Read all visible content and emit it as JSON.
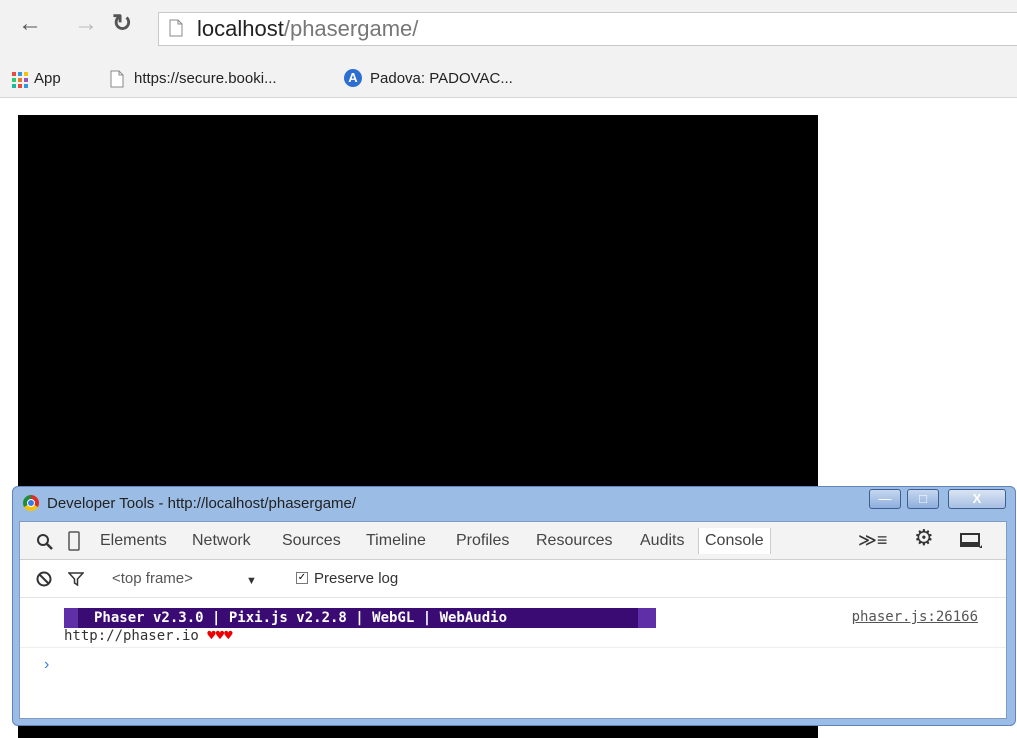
{
  "browser": {
    "url_host": "localhost",
    "url_path": "/phasergame/",
    "bookmarks": [
      {
        "label": "App"
      },
      {
        "label": "https://secure.booki..."
      },
      {
        "label": "Padova: PADOVAC..."
      }
    ]
  },
  "devtools": {
    "title": "Developer Tools - http://localhost/phasergame/",
    "tabs": [
      "Elements",
      "Network",
      "Sources",
      "Timeline",
      "Profiles",
      "Resources",
      "Audits",
      "Console"
    ],
    "active_tab": "Console",
    "frame_selector": "<top frame>",
    "preserve_log_label": "Preserve log",
    "preserve_log_checked": true,
    "window_buttons": {
      "minimize": "—",
      "maximize": "□",
      "close": "X"
    },
    "console": {
      "banner": "Phaser v2.3.0 | Pixi.js v2.2.8 | WebGL | WebAudio",
      "link_line": "http://phaser.io",
      "hearts": "♥♥♥",
      "source": "phaser.js:26166",
      "prompt": "›"
    }
  },
  "colors": {
    "banner_outer": "#5f2fa8",
    "banner_inner": "#3b0b74",
    "hearts": "#ee0000",
    "devtools_frame": "#9bbce4"
  }
}
